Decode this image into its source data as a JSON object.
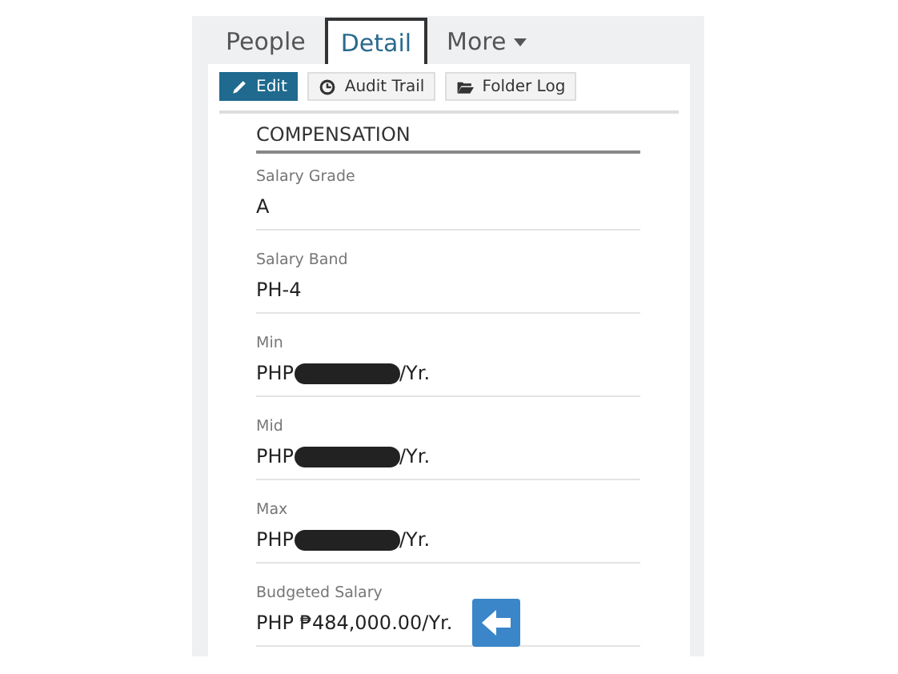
{
  "tabs": [
    {
      "label": "People",
      "selected": false,
      "kind": "plain"
    },
    {
      "label": "Detail",
      "selected": true,
      "kind": "plain"
    },
    {
      "label": "More",
      "selected": false,
      "kind": "dropdown"
    }
  ],
  "toolbar": [
    {
      "label": "Edit",
      "kind": "primary"
    },
    {
      "label": "Audit Trail",
      "kind": "secondary"
    },
    {
      "label": "Folder Log",
      "kind": "secondary"
    }
  ],
  "section": {
    "title": "COMPENSATION"
  },
  "fields": [
    {
      "label": "Salary Grade",
      "kind": "plain",
      "value": "A"
    },
    {
      "label": "Salary Band",
      "kind": "plain",
      "value": "PH-4"
    },
    {
      "label": "Min",
      "kind": "redacted",
      "prefix": "PHP",
      "suffix": "/Yr."
    },
    {
      "label": "Mid",
      "kind": "redacted",
      "prefix": "PHP",
      "suffix": "/Yr."
    },
    {
      "label": "Max",
      "kind": "redacted",
      "prefix": "PHP",
      "suffix": "/Yr."
    },
    {
      "label": "Budgeted Salary",
      "kind": "plain",
      "value": "PHP ₱484,000.00/Yr.",
      "pointer": true
    }
  ]
}
